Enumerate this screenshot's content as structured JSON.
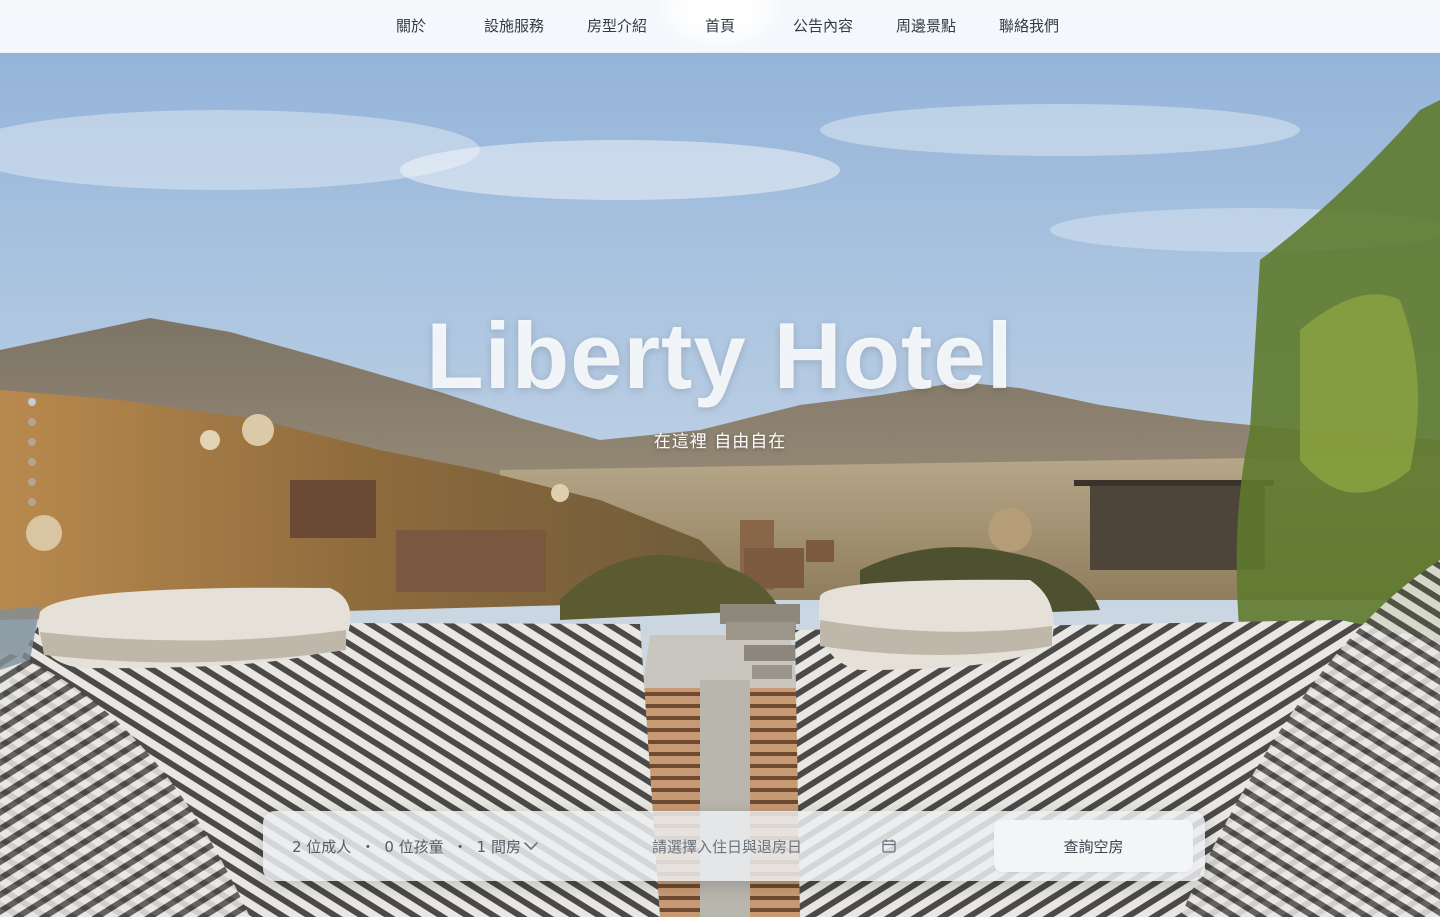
{
  "nav": {
    "items": [
      {
        "label": "關於"
      },
      {
        "label": "設施服務"
      },
      {
        "label": "房型介紹"
      },
      {
        "label": "首頁"
      },
      {
        "label": "公告內容"
      },
      {
        "label": "周邊景點"
      },
      {
        "label": "聯絡我們"
      }
    ],
    "active": "首頁"
  },
  "hero": {
    "title": "Liberty Hotel",
    "subtitle": "在這裡 自由自在",
    "slide_count": 6,
    "active_slide": 1
  },
  "booking": {
    "adults": "2 位成人",
    "children": "0 位孩童",
    "rooms": "1 間房",
    "separator": "・",
    "date_placeholder": "請選擇入住日與退房日",
    "search_label": "查詢空房"
  },
  "icons": {
    "guests_dropdown": "chevron-down-icon",
    "date_picker": "calendar-icon"
  },
  "colors": {
    "nav_text": "#333b46",
    "booking_bg": "#eceef0",
    "button_bg": "#f4f5f6"
  }
}
